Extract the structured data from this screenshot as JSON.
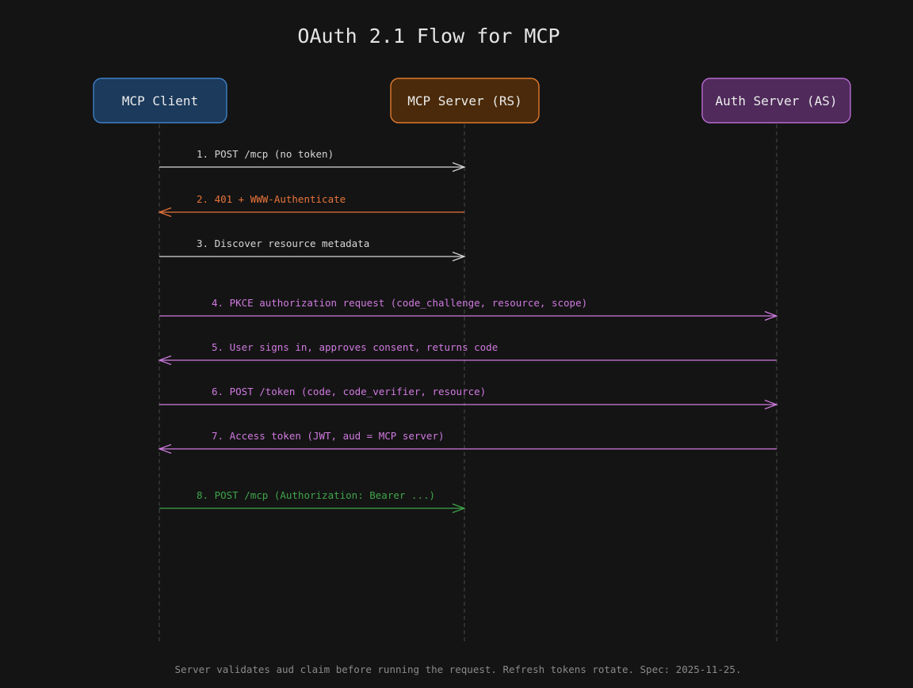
{
  "title": "OAuth 2.1 Flow for MCP",
  "actors": [
    {
      "id": "client",
      "label": "MCP Client",
      "fill": "#1b3a5c",
      "stroke": "#3f7fc4"
    },
    {
      "id": "rs",
      "label": "MCP Server (RS)",
      "fill": "#4a2a0a",
      "stroke": "#e07a2e"
    },
    {
      "id": "as",
      "label": "Auth Server (AS)",
      "fill": "#4f2a5a",
      "stroke": "#b66ad0"
    }
  ],
  "messages": [
    {
      "label": "1.  POST /mcp  (no token)",
      "from": "client",
      "to": "rs",
      "color": "#d6d6d6"
    },
    {
      "label": "2.  401  +  WWW-Authenticate",
      "from": "rs",
      "to": "client",
      "color": "#e8743b"
    },
    {
      "label": "3.  Discover resource metadata",
      "from": "client",
      "to": "rs",
      "color": "#d6d6d6"
    },
    {
      "label": "4.  PKCE authorization request  (code_challenge, resource, scope)",
      "from": "client",
      "to": "as",
      "color": "#d07ae0"
    },
    {
      "label": "5.  User signs in, approves consent, returns code",
      "from": "as",
      "to": "client",
      "color": "#d07ae0"
    },
    {
      "label": "6.  POST /token  (code, code_verifier, resource)",
      "from": "client",
      "to": "as",
      "color": "#d07ae0"
    },
    {
      "label": "7.  Access token  (JWT, aud = MCP server)",
      "from": "as",
      "to": "client",
      "color": "#d07ae0"
    },
    {
      "label": "8.  POST /mcp  (Authorization: Bearer ...)",
      "from": "client",
      "to": "rs",
      "color": "#3fa54a"
    }
  ],
  "footer": "Server validates aud claim before running the request.  Refresh tokens rotate.  Spec: 2025-11-25."
}
